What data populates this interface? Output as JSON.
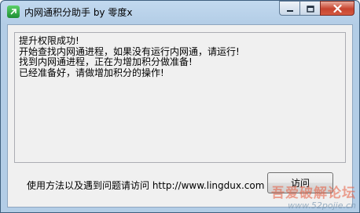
{
  "window": {
    "title": "内网通积分助手 by 零度x"
  },
  "caption_buttons": {
    "minimize": "minimize",
    "maximize": "maximize",
    "close": "close"
  },
  "log": {
    "lines": [
      "提升权限成功!",
      "开始查找内网通进程，如果没有运行内网通，请运行!",
      "找到内网通进程，正在为增加积分做准备!",
      "已经准备好，请做增加积分的操作!"
    ]
  },
  "footer": {
    "help_text": "使用方法以及遇到问题请访问 http://www.lingdux.com",
    "button_label": "访问"
  },
  "watermark": {
    "main": "吾爱破解论坛",
    "url": "www.52pojie.cn"
  },
  "colors": {
    "titlebar": "#b9d1ea",
    "close_button": "#c7442f",
    "client_bg": "#f0f0f0"
  }
}
